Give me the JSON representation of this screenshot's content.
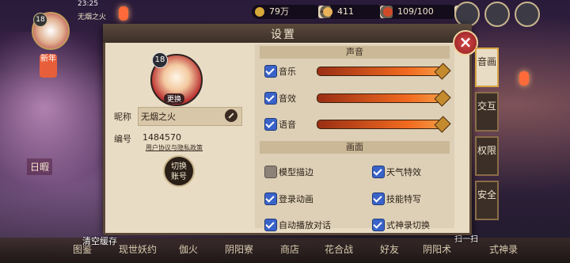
{
  "status_bar": {
    "time": "23:25"
  },
  "player": {
    "name": "无烟之火",
    "level": "18",
    "uid": "1484570"
  },
  "currency": {
    "gold": "79万",
    "jade": "411",
    "stamina": "109/100"
  },
  "left_hud": {
    "event_badge": "新年",
    "daily": "日暇"
  },
  "dialog": {
    "title": "设置",
    "profile": {
      "change_label": "更换",
      "nickname_label": "昵称",
      "nickname_value": "无烟之火",
      "uid_label": "编号",
      "uid_value": "1484570",
      "policy_link": "用户协议与隐私政策",
      "switch_account": "切换\n账号"
    },
    "sound": {
      "section": "声音",
      "music": {
        "label": "音乐",
        "checked": true,
        "level": 1.0
      },
      "effects": {
        "label": "音效",
        "checked": true,
        "level": 1.0
      },
      "voice": {
        "label": "语音",
        "checked": true,
        "level": 1.0
      }
    },
    "graphics": {
      "section": "画面",
      "options": [
        {
          "label": "模型描边",
          "checked": false
        },
        {
          "label": "天气特效",
          "checked": true
        },
        {
          "label": "登录动画",
          "checked": true
        },
        {
          "label": "技能特写",
          "checked": true
        },
        {
          "label": "自动播放对话",
          "checked": true
        },
        {
          "label": "式神录切换",
          "checked": true
        }
      ]
    },
    "tabs": [
      "音画",
      "交互",
      "权限",
      "安全"
    ]
  },
  "bottom": {
    "clear_cache": "清空缓存",
    "scan": "扫一扫",
    "nav": [
      "图鉴",
      "现世妖约",
      "伽火",
      "阴阳寮",
      "商店",
      "花合战",
      "好友",
      "阴阳术",
      "式神录"
    ]
  },
  "colors": {
    "accent_blue": "#3a63c9",
    "slider_orange": "#f26a1f",
    "close_red": "#d84a4a"
  }
}
